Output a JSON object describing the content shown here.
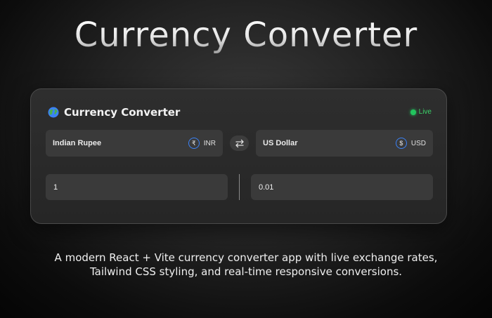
{
  "hero": {
    "title": "Currency Converter"
  },
  "card": {
    "title": "Currency Converter",
    "status": "Live",
    "globe_icon": "globe-icon",
    "swap_icon": "swap-arrows-icon",
    "from": {
      "name": "Indian Rupee",
      "symbol": "₹",
      "code": "INR",
      "amount": "1"
    },
    "to": {
      "name": "US Dollar",
      "symbol": "$",
      "code": "USD",
      "amount": "0.01"
    }
  },
  "description": {
    "line1": "A modern React + Vite currency converter app with live exchange rates,",
    "line2": "Tailwind CSS styling, and real-time responsive conversions."
  },
  "colors": {
    "accent": "#3b82f6",
    "live": "#22c55e",
    "field_bg": "#3a3a3a"
  }
}
